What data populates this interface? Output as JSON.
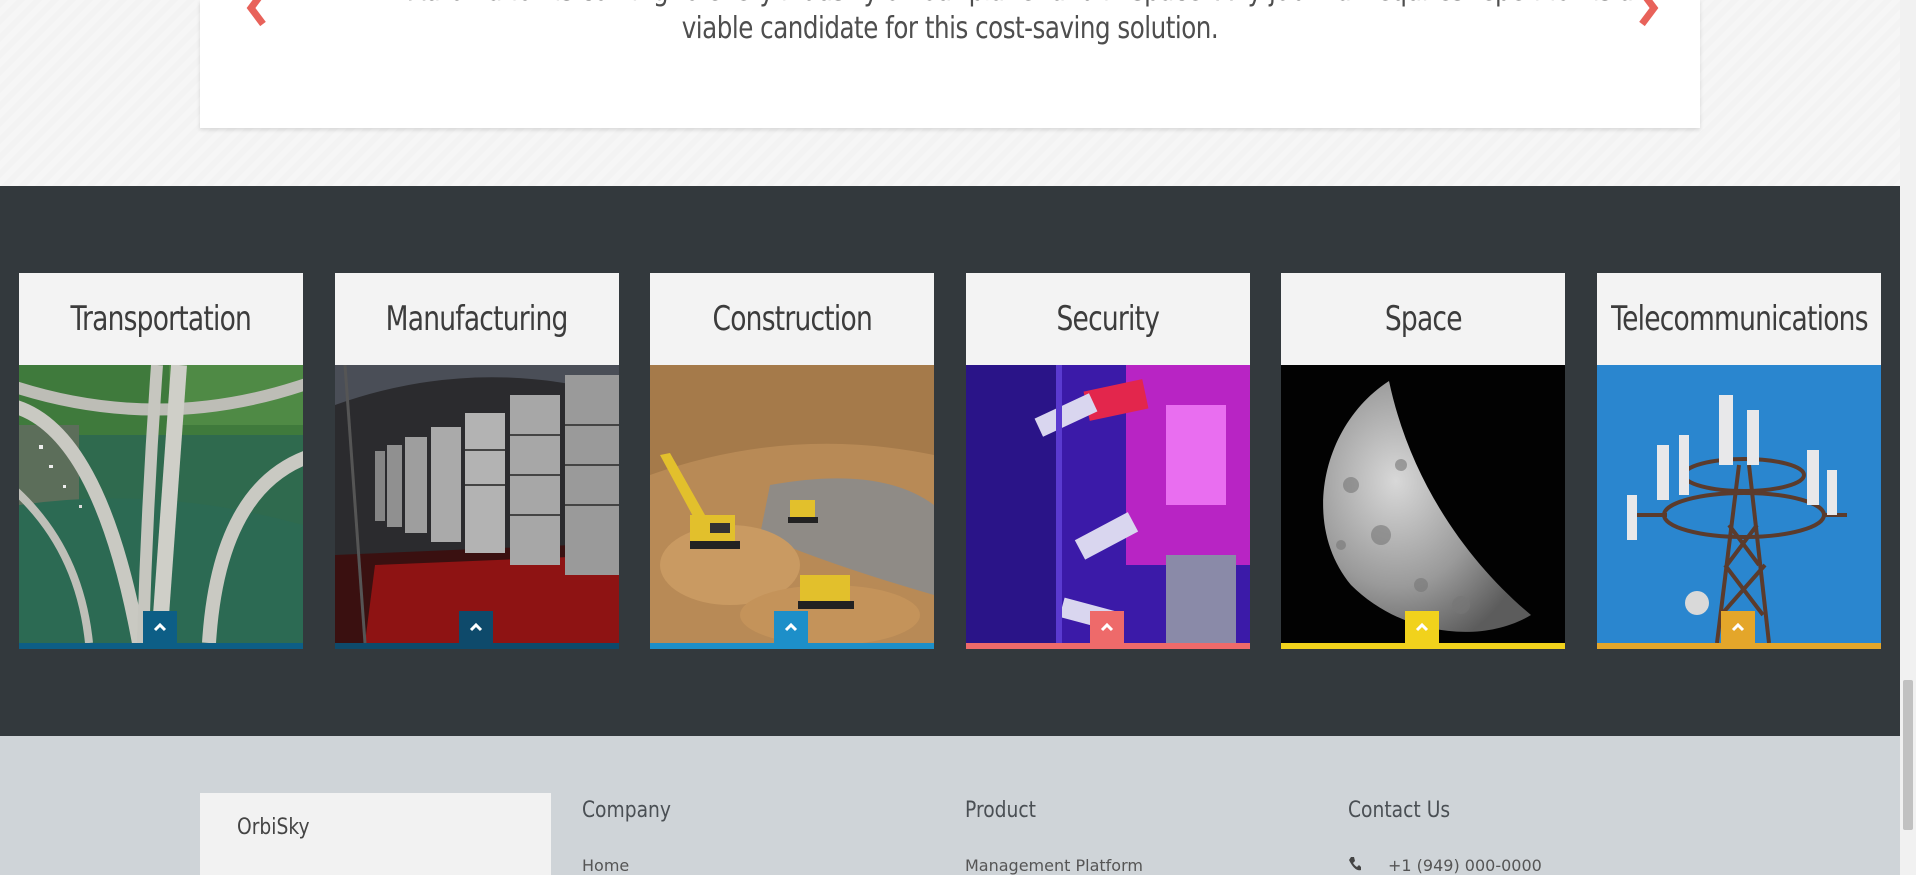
{
  "testimonial": {
    "quote_line1": "Automation is coming to every industry on our planet and in space. Any job that requires repetition is a",
    "quote_line2": "viable candidate for this cost-saving solution.",
    "prev_icon": "chevron-left-icon",
    "next_icon": "chevron-right-icon",
    "arrow_color": "#e8625a"
  },
  "industries": {
    "background": "#33393d",
    "cards": [
      {
        "label": "Transportation",
        "accent": "#0d5e86",
        "image": "highway-interchange-aerial"
      },
      {
        "label": "Manufacturing",
        "accent": "#0e4a6b",
        "image": "factory-tanks"
      },
      {
        "label": "Construction",
        "accent": "#1d8fc9",
        "image": "excavators-site"
      },
      {
        "label": "Security",
        "accent": "#ee6a6a",
        "image": "security-cameras"
      },
      {
        "label": "Space",
        "accent": "#f1d21c",
        "image": "moon"
      },
      {
        "label": "Telecommunications",
        "accent": "#e4a62a",
        "image": "cell-tower"
      }
    ],
    "toggle_icon": "chevron-up-icon"
  },
  "footer": {
    "brand": "OrbiSky",
    "columns": [
      {
        "title": "Company",
        "first_link": "Home"
      },
      {
        "title": "Product",
        "first_link": "Management Platform"
      },
      {
        "title": "Contact Us",
        "first_link": "+1 (949) 000-0000"
      }
    ]
  }
}
